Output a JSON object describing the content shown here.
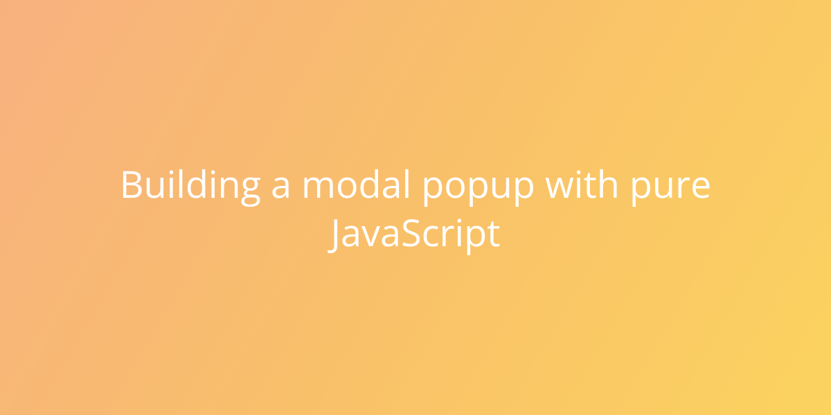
{
  "hero": {
    "title": "Building a modal popup with pure JavaScript"
  }
}
